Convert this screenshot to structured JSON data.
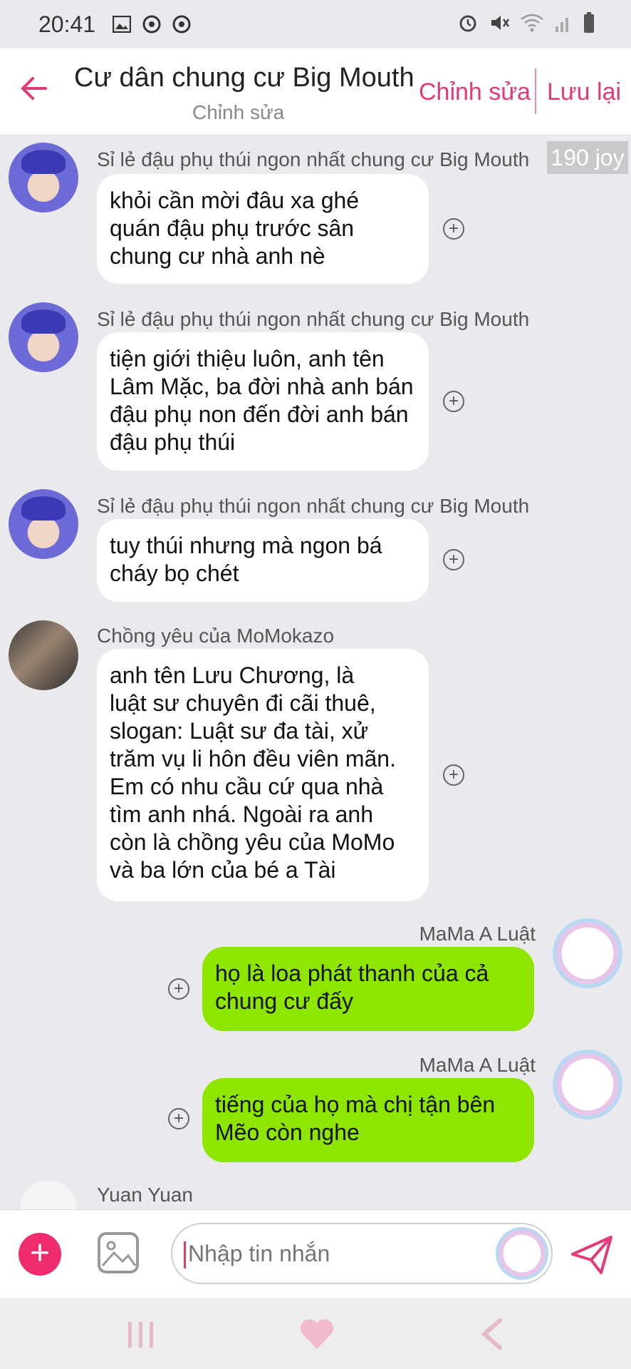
{
  "status_bar": {
    "time": "20:41"
  },
  "header": {
    "title": "Cư dân chung cư Big Mouth",
    "subtitle": "Chỉnh sửa",
    "edit_label": "Chỉnh sửa",
    "save_label": "Lưu lại"
  },
  "joy_badge": "190 joy",
  "messages": [
    {
      "sender": "Sỉ lẻ đậu phụ thúi ngon nhất chung cư Big Mouth",
      "text": "khỏi cần mời đâu xa ghé\nquán đậu phụ trước sân\nchung cư nhà anh nè",
      "mine": false
    },
    {
      "sender": "Sỉ lẻ đậu phụ thúi ngon nhất chung cư Big Mouth",
      "text": "tiện giới thiệu luôn, anh tên\nLâm Mặc, ba đời nhà anh bán\nđậu phụ non đến đời anh bán\nđậu phụ thúi",
      "mine": false
    },
    {
      "sender": "Sỉ lẻ đậu phụ thúi ngon nhất chung cư Big Mouth",
      "text": "tuy thúi nhưng mà ngon bá\ncháy bọ chét",
      "mine": false
    },
    {
      "sender": "Chồng yêu của MoMokazo",
      "text": "anh tên Lưu Chương, là\nluật sư chuyên đi cãi thuê,\nslogan: Luật sư đa tài, xử\ntrăm vụ li hôn đều viên mãn.\nEm có nhu cầu cứ qua nhà\ntìm anh nhá. Ngoài ra anh\ncòn là chồng yêu của MoMo\nvà ba lớn của bé a Tài",
      "mine": false
    },
    {
      "sender": "MaMa A Luật",
      "text": "họ là loa phát thanh của cả\nchung cư đấy",
      "mine": true
    },
    {
      "sender": "MaMa A Luật",
      "text": "tiếng của họ mà chị tận bên\nMẽo còn nghe",
      "mine": true
    },
    {
      "sender": "Yuan Yuan",
      "text": "",
      "mine": false
    }
  ],
  "composer": {
    "placeholder": "Nhập tin nhắn"
  },
  "colors": {
    "accent": "#e2397c",
    "my_bubble": "#8ee600",
    "other_bubble": "#ffffff"
  }
}
